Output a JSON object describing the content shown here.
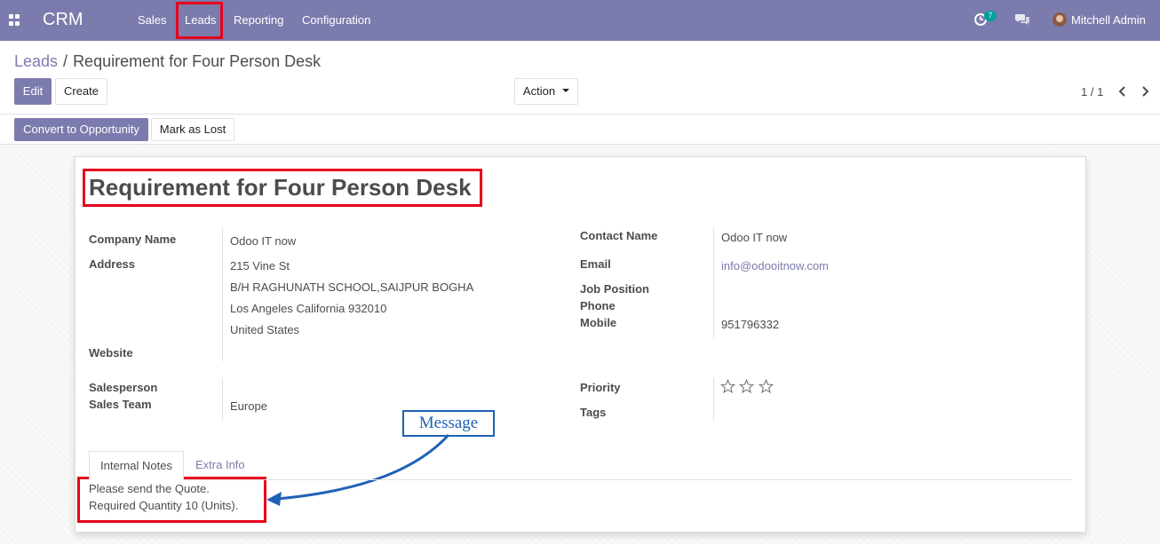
{
  "navbar": {
    "brand": "CRM",
    "menu": [
      "Sales",
      "Leads",
      "Reporting",
      "Configuration"
    ],
    "activity_count": "7",
    "user_name": "Mitchell Admin"
  },
  "breadcrumb": {
    "parent": "Leads",
    "separator": "/",
    "current": "Requirement for Four Person Desk"
  },
  "buttons": {
    "edit": "Edit",
    "create": "Create",
    "action": "Action",
    "convert": "Convert to Opportunity",
    "mark_lost": "Mark as Lost"
  },
  "pager": {
    "value": "1 / 1"
  },
  "lead": {
    "title": "Requirement for Four Person Desk",
    "company_name_label": "Company Name",
    "company_name": "Odoo IT now",
    "address_label": "Address",
    "address_lines": [
      "215 Vine St",
      "B/H RAGHUNATH SCHOOL,SAIJPUR BOGHA",
      "Los Angeles  California  932010",
      "United States"
    ],
    "website_label": "Website",
    "contact_name_label": "Contact Name",
    "contact_name": "Odoo IT now",
    "email_label": "Email",
    "email": "info@odooitnow.com",
    "job_position_label": "Job Position",
    "phone_label": "Phone",
    "mobile_label": "Mobile",
    "mobile": "951796332",
    "salesperson_label": "Salesperson",
    "sales_team_label": "Sales Team",
    "sales_team": "Europe",
    "priority_label": "Priority",
    "priority_stars": 0,
    "priority_max": 3,
    "tags_label": "Tags"
  },
  "tabs": [
    "Internal Notes",
    "Extra Info"
  ],
  "notes": [
    "Please send the Quote.",
    "Required Quantity 10 (Units)."
  ],
  "annotation": {
    "label": "Message",
    "color": "#1f62b5"
  },
  "colors": {
    "brand": "#7c7bad",
    "highlight": "#e6001c"
  }
}
